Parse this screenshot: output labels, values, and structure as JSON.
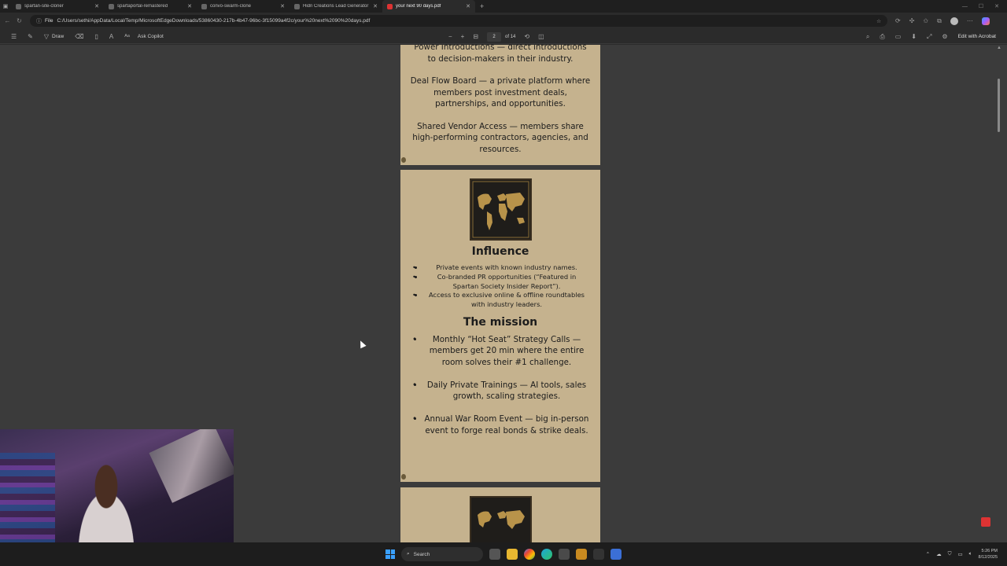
{
  "browser": {
    "tabs": [
      {
        "title": "spartan-site-cloner",
        "active": false
      },
      {
        "title": "spartaportal-remastered",
        "active": false
      },
      {
        "title": "convo-swarm-clone",
        "active": false
      },
      {
        "title": "Hidn Creations Lead Generator",
        "active": false
      },
      {
        "title": "your next 90 days.pdf",
        "active": true
      }
    ],
    "url_prefix": "File",
    "url": "C:/Users/sethi/AppData/Local/Temp/MicrosoftEdgeDownloads/53860430-217b-4b47-96bc-3f15099a4f2c/your%20next%2090%20days.pdf"
  },
  "pdf_toolbar": {
    "draw_label": "Draw",
    "ask_copilot_label": "Ask Copilot",
    "current_page": "2",
    "total_pages": "of 14",
    "edit_with_acrobat_label": "Edit with Acrobat"
  },
  "page1": {
    "lines": [
      "Power Introductions — direct introductions to decision-makers in their industry.",
      "Deal Flow Board — a private platform where members post investment deals, partnerships, and opportunities.",
      "Shared Vendor Access — members share high-performing contractors, agencies, and resources."
    ]
  },
  "page2": {
    "heading_influence": "Influence",
    "influence_items": [
      "Private events with known industry names.",
      "Co-branded PR opportunities (“Featured in Spartan Society Insider Report”).",
      "Access to exclusive online & offline roundtables with industry leaders."
    ],
    "heading_mission": "The mission",
    "mission_items": [
      "Monthly “Hot Seat” Strategy Calls — members get 20 min where the entire room solves their #1 challenge.",
      "Daily Private Trainings — AI tools, sales growth, scaling strategies.",
      "Annual War Room Event — big in-person event to forge real bonds & strike deals."
    ]
  },
  "taskbar": {
    "search_placeholder": "Search",
    "time": "5:26 PM",
    "date": "8/12/2025"
  },
  "colors": {
    "page_bg": "#c5b28e",
    "viewer_bg": "#3b3b3b",
    "map_gold": "#b8934a"
  }
}
